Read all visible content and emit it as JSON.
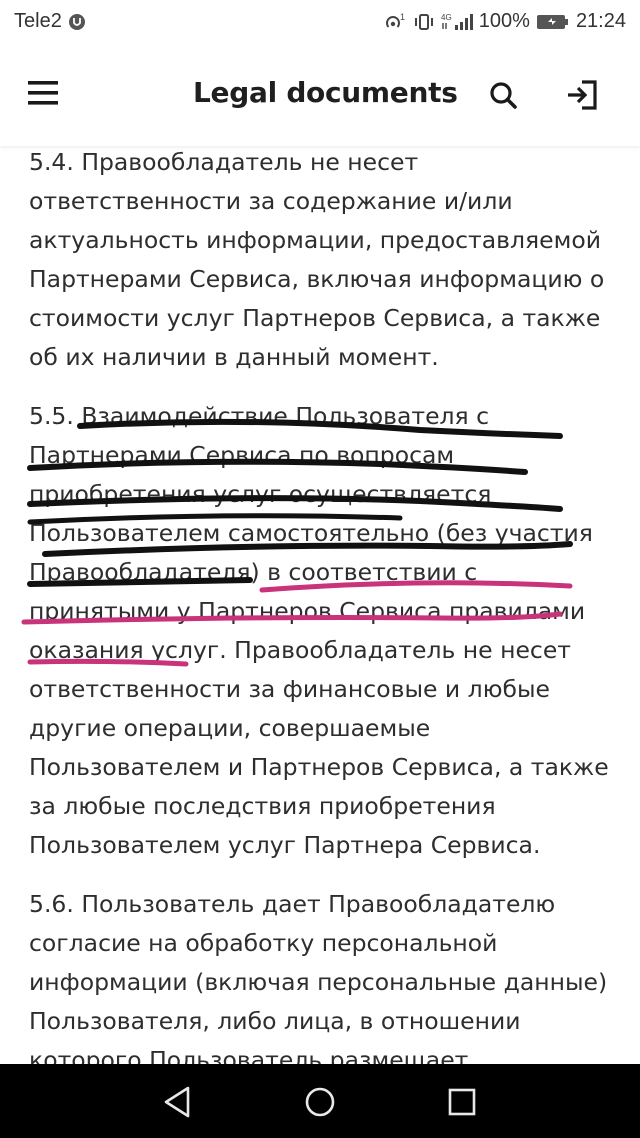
{
  "status_bar": {
    "carrier": "Tele2",
    "network": "4G",
    "battery": "100%",
    "time": "21:24"
  },
  "header": {
    "title": "Legal documents",
    "icons": [
      "menu-icon",
      "search-icon",
      "login-icon"
    ]
  },
  "document": {
    "paragraphs": [
      {
        "lines": [
          "5.4. Правообладатель не несет",
          "ответственности за содержание и/или",
          "актуальность информации, предоставляемой",
          "Партнерами Сервиса, включая информацию о",
          "стоимости услуг Партнеров Сервиса, а также",
          "об их наличии в данный момент."
        ]
      },
      {
        "lines": [
          "5.5. Взаимодействие Пользователя с",
          "Партнерами Сервиса по вопросам",
          "приобретения услуг осуществляется",
          "Пользователем самостоятельно (без участия",
          "Правообладателя) в соответствии с",
          "принятыми у Партнеров Сервиса правилами",
          "оказания услуг. Правообладатель не несет",
          "ответственности за финансовые и любые",
          "другие операции, совершаемые",
          "Пользователем и Партнеров Сервиса, а также",
          "за любые последствия приобретения",
          "Пользователем услуг Партнера Сервиса."
        ]
      },
      {
        "lines": [
          "5.6. Пользователь дает Правообладателю",
          "согласие на обработку персональной",
          "информации (включая персональные данные)",
          "Пользователя, либо лица, в отношении",
          "которого Пользователь размещает"
        ]
      }
    ]
  },
  "annotations": {
    "black_color": "#111111",
    "pink_color": "#c8337a"
  },
  "nav_bar": {
    "icons": [
      "back-icon",
      "home-icon",
      "recents-icon"
    ]
  }
}
